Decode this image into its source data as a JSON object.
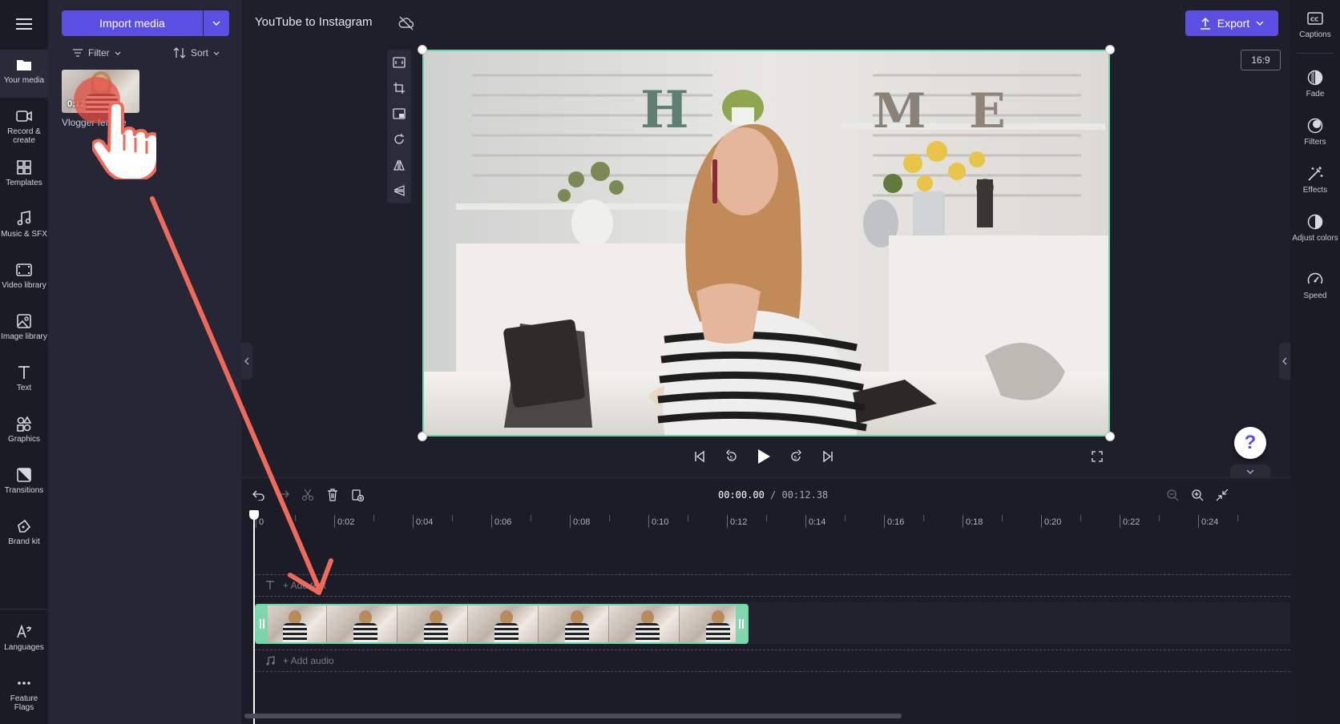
{
  "left_rail": {
    "items": [
      {
        "label": "Your media",
        "icon": "folder-icon"
      },
      {
        "label": "Record & create",
        "icon": "camera-icon"
      },
      {
        "label": "Templates",
        "icon": "templates-icon"
      },
      {
        "label": "Music & SFX",
        "icon": "music-icon"
      },
      {
        "label": "Video library",
        "icon": "film-icon"
      },
      {
        "label": "Image library",
        "icon": "image-icon"
      },
      {
        "label": "Text",
        "icon": "text-icon"
      },
      {
        "label": "Graphics",
        "icon": "graphics-icon"
      },
      {
        "label": "Transitions",
        "icon": "transitions-icon"
      },
      {
        "label": "Brand kit",
        "icon": "brand-kit-icon"
      },
      {
        "label": "Languages",
        "icon": "languages-icon"
      },
      {
        "label": "Feature Flags",
        "icon": "more-icon"
      }
    ]
  },
  "media_panel": {
    "import_label": "Import media",
    "filter_label": "Filter",
    "sort_label": "Sort",
    "asset": {
      "name": "Vlogger female",
      "duration": "0:12"
    }
  },
  "top_bar": {
    "project_title": "YouTube to Instagram",
    "export_label": "Export",
    "aspect_ratio": "16:9"
  },
  "right_panel": {
    "items": [
      {
        "label": "Captions",
        "icon": "captions-icon"
      },
      {
        "label": "Fade",
        "icon": "fade-icon"
      },
      {
        "label": "Filters",
        "icon": "filters-icon"
      },
      {
        "label": "Effects",
        "icon": "effects-icon"
      },
      {
        "label": "Adjust colors",
        "icon": "adjust-colors-icon"
      },
      {
        "label": "Speed",
        "icon": "speed-icon"
      }
    ]
  },
  "timeline": {
    "current_time": "00:00.00",
    "total_time": "/ 00:12.38",
    "ruler_labels": [
      "0",
      "0:02",
      "0:04",
      "0:06",
      "0:08",
      "0:10",
      "0:12",
      "0:14",
      "0:16",
      "0:18",
      "0:20",
      "0:22",
      "0:24"
    ],
    "add_text_label": "+ Add text",
    "add_audio_label": "+ Add audio"
  },
  "help": {
    "label": "?"
  },
  "colors": {
    "accent": "#5b4fe3",
    "selection": "#6ed7a4",
    "drag_arrow": "#f06a5a"
  }
}
